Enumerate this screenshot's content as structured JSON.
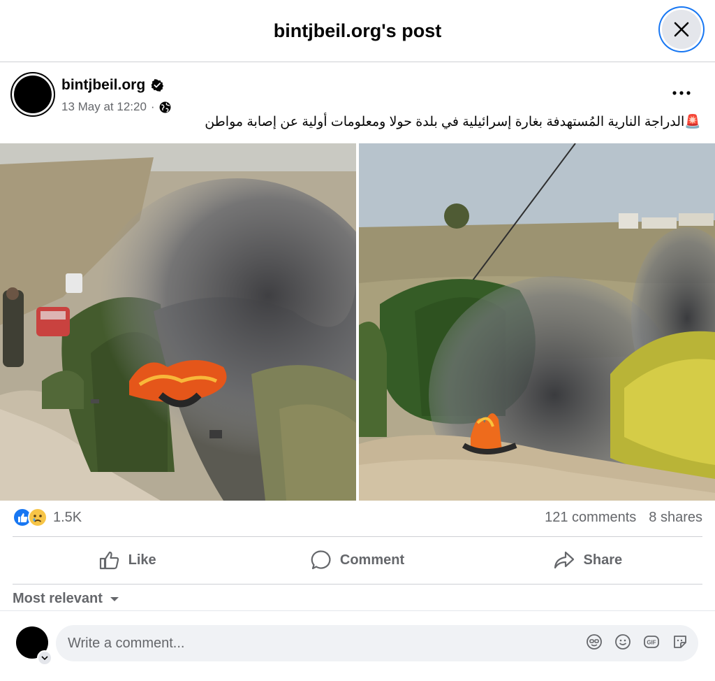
{
  "header": {
    "title": "bintjbeil.org's post"
  },
  "post": {
    "author": "bintjbeil.org",
    "timestamp": "13 May at 12:20",
    "separator": "·",
    "text_emoji": "🚨",
    "text": "الدراجة النارية المُستهدفة بغارة إسرائيلية في بلدة حولا ومعلومات أولية عن إصابة مواطن"
  },
  "stats": {
    "reactions_count": "1.5K",
    "comments": "121 comments",
    "shares": "8 shares"
  },
  "actions": {
    "like": "Like",
    "comment": "Comment",
    "share": "Share"
  },
  "comments": {
    "sort_label": "Most relevant"
  },
  "composer": {
    "placeholder": "Write a comment..."
  },
  "colors": {
    "brand_blue": "#1877f2",
    "secondary_text": "#65676b",
    "divider": "#ced0d4"
  },
  "icons": [
    "close-icon",
    "verified-badge-icon",
    "globe-icon",
    "more-icon",
    "like-reaction-icon",
    "sad-reaction-icon",
    "like-icon",
    "comment-icon",
    "share-icon",
    "caret-down-icon",
    "avatar-icon",
    "sticker-face-icon",
    "emoji-icon",
    "gif-icon",
    "sticker-icon"
  ]
}
